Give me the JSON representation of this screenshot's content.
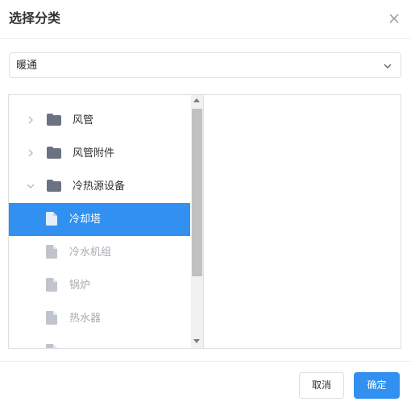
{
  "dialog": {
    "title": "选择分类",
    "close_icon": "close-icon"
  },
  "select": {
    "value": "暖通",
    "arrow_icon": "chevron-down-icon"
  },
  "tree": {
    "items": [
      {
        "label": "风管",
        "type": "folder",
        "expanded": false,
        "selected": false
      },
      {
        "label": "风管附件",
        "type": "folder",
        "expanded": false,
        "selected": false
      },
      {
        "label": "冷热源设备",
        "type": "folder",
        "expanded": true,
        "selected": false
      },
      {
        "label": "冷却塔",
        "type": "leaf",
        "selected": true
      },
      {
        "label": "冷水机组",
        "type": "leaf",
        "selected": false
      },
      {
        "label": "锅炉",
        "type": "leaf",
        "selected": false
      },
      {
        "label": "热水器",
        "type": "leaf",
        "selected": false
      }
    ]
  },
  "footer": {
    "cancel_label": "取消",
    "ok_label": "确定"
  },
  "colors": {
    "accent": "#3291f0",
    "folder_icon": "#6b7281",
    "leaf_icon": "#c0c4cc"
  }
}
